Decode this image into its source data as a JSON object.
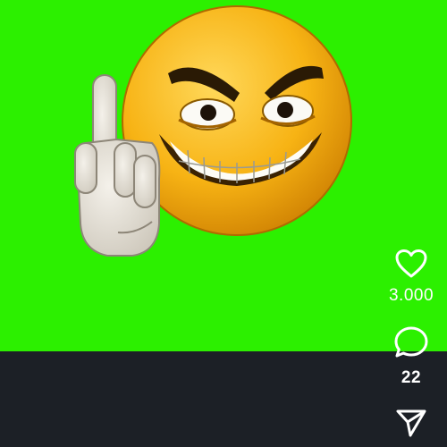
{
  "video": {
    "background_color": "#2cf000",
    "sticker": "angry-grinning-emoji-middle-finger"
  },
  "actions": {
    "like": {
      "icon": "heart-icon",
      "count": "3.000"
    },
    "comment": {
      "icon": "comment-bubble-icon",
      "count": "22"
    },
    "share": {
      "icon": "send-paper-plane-icon"
    }
  }
}
